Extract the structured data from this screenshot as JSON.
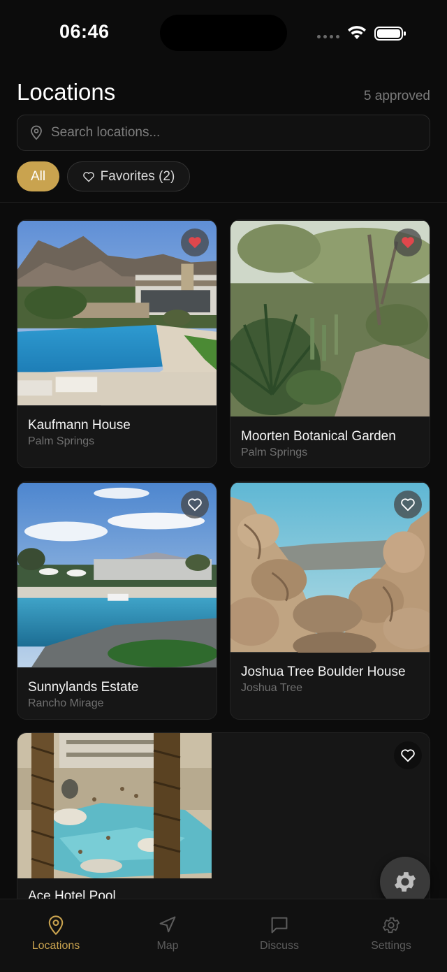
{
  "status_bar": {
    "time": "06:46"
  },
  "header": {
    "title": "Locations",
    "approved": "5 approved"
  },
  "search": {
    "placeholder": "Search locations..."
  },
  "filters": {
    "all": "All",
    "favorites": "Favorites (2)"
  },
  "locations": [
    {
      "name": "Kaufmann House",
      "area": "Palm Springs",
      "favorite": true
    },
    {
      "name": "Moorten Botanical Garden",
      "area": "Palm Springs",
      "favorite": true
    },
    {
      "name": "Sunnylands Estate",
      "area": "Rancho Mirage",
      "favorite": false
    },
    {
      "name": "Joshua Tree Boulder House",
      "area": "Joshua Tree",
      "favorite": false
    },
    {
      "name": "Ace Hotel Pool",
      "area": "",
      "favorite": false
    }
  ],
  "tabs": [
    {
      "label": "Locations",
      "icon": "map-pin-icon",
      "active": true
    },
    {
      "label": "Map",
      "icon": "navigation-icon",
      "active": false
    },
    {
      "label": "Discuss",
      "icon": "chat-icon",
      "active": false
    },
    {
      "label": "Settings",
      "icon": "gear-icon",
      "active": false
    }
  ],
  "colors": {
    "accent": "#c9a34f",
    "favorite": "#e0474c",
    "background": "#0c0c0c",
    "card": "#161616"
  }
}
